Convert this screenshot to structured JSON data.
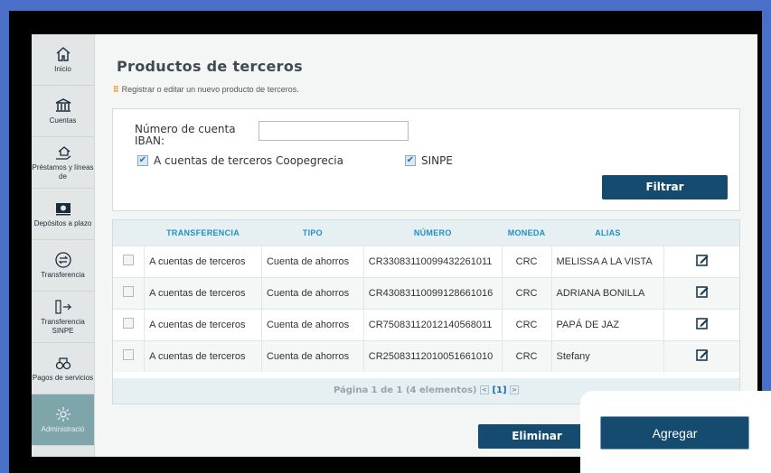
{
  "sidebar": {
    "items": [
      {
        "label": "Inicio",
        "icon": "home-icon",
        "glyph": "⌂"
      },
      {
        "label": "Cuentas",
        "icon": "bank-icon",
        "glyph": "🏛"
      },
      {
        "label": "Préstamos y líneas de",
        "icon": "loan-house-icon",
        "glyph": "⌂"
      },
      {
        "label": "Depósitos a plazo",
        "icon": "cash-icon",
        "glyph": "▣"
      },
      {
        "label": "Transferencia",
        "icon": "transfer-icon",
        "glyph": "⇄"
      },
      {
        "label": "Transferencia SINPE",
        "icon": "sinpe-transfer-icon",
        "glyph": "▯→"
      },
      {
        "label": "Pagos de servicios",
        "icon": "service-payments-icon",
        "glyph": "⚙"
      },
      {
        "label": "Administració",
        "icon": "admin-gear-icon",
        "glyph": "⚙"
      }
    ]
  },
  "header": {
    "title": "Productos de terceros",
    "subtitle": "Registrar o editar un nuevo producto de terceros.",
    "subtitle_dots": "⠿"
  },
  "filter": {
    "account_label": "Número de cuenta IBAN:",
    "account_value": "",
    "check_coopegrecia_label": "A cuentas de terceros Coopegrecia",
    "check_sinpe_label": "SINPE",
    "filter_button": "Filtrar"
  },
  "table": {
    "headers": [
      "TRANSFERENCIA",
      "TIPO",
      "NÚMERO",
      "MONEDA",
      "ALIAS"
    ],
    "rows": [
      {
        "transferencia": "A cuentas de terceros",
        "tipo": "Cuenta de ahorros",
        "numero": "CR33083110099432261011",
        "moneda": "CRC",
        "alias": "MELISSA A LA VISTA"
      },
      {
        "transferencia": "A cuentas de terceros",
        "tipo": "Cuenta de ahorros",
        "numero": "CR43083110099128661016",
        "moneda": "CRC",
        "alias": "ADRIANA BONILLA"
      },
      {
        "transferencia": "A cuentas de terceros",
        "tipo": "Cuenta de ahorros",
        "numero": "CR75083112012140568011",
        "moneda": "CRC",
        "alias": "PAPÁ DE JAZ"
      },
      {
        "transferencia": "A cuentas de terceros",
        "tipo": "Cuenta de ahorros",
        "numero": "CR25083112010051661010",
        "moneda": "CRC",
        "alias": "Stefany"
      }
    ],
    "pager_text": "Página 1 de 1 (4 elementos)",
    "pager_current": "[1]",
    "pager_prev": "<",
    "pager_next": ">"
  },
  "actions": {
    "delete_button": "Eliminar",
    "add_button": "Agregar"
  },
  "colors": {
    "primary": "#144b6f",
    "accent": "#1f8fc9",
    "frame": "#4a6fc8"
  }
}
